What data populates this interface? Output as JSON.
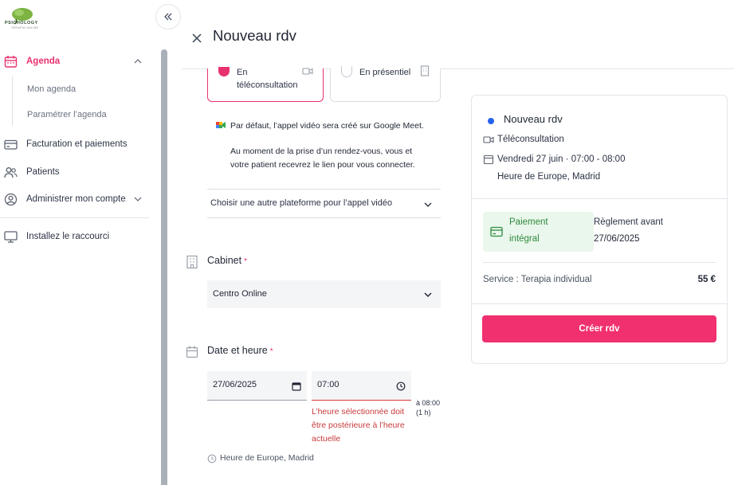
{
  "sidebar": {
    "logo_text": "PSICHOLOGY",
    "logo_sub": "TERAPIA ONLINE",
    "items": [
      {
        "label": "Agenda"
      },
      {
        "label": "Facturation et paiements"
      },
      {
        "label": "Patients"
      },
      {
        "label": "Administrer mon compte"
      },
      {
        "label": "Installez le raccourci"
      }
    ],
    "agenda_sub": [
      {
        "label": "Mon agenda"
      },
      {
        "label": "Paramétrer l’agenda"
      }
    ]
  },
  "header": {
    "title": "Nouveau rdv"
  },
  "modes": {
    "tele_line1": "En",
    "tele_line2": "téléconsultation",
    "presentiel": "En présentiel"
  },
  "video": {
    "info1": "Par défaut, l’appel vidéo sera créé sur Google Meet.",
    "info2": "Au moment de la prise d’un rendez-vous, vous et",
    "info3": "votre patient recevrez le lien pour vous connecter.",
    "platform_select": "Choisir une autre plateforme pour l’appel vidéo"
  },
  "cabinet": {
    "label": "Cabinet",
    "required": "*",
    "value": "Centro Online"
  },
  "datetime": {
    "label": "Date et heure",
    "required": "*",
    "date": "27/06/2025",
    "time": "07:00",
    "end_line1": "à 08:00",
    "end_line2": "(1 h)",
    "error1": "L’heure sélectionnée doit",
    "error2": "être postérieure à l’heure",
    "error3": "actuelle",
    "timezone": "Heure de Europe, Madrid"
  },
  "summary": {
    "title": "Nouveau rdv",
    "mode": "Téléconsultation",
    "datetime": "Vendredi 27 juin · 07:00 - 08:00",
    "timezone": "Heure de Europe, Madrid",
    "payment_line1": "Paiement",
    "payment_line2": "intégral",
    "settle_line1": "Règlement avant",
    "settle_date": "27/06/2025",
    "service": "Service : Terapia individual",
    "price": "55 €",
    "create_label": "Créer rdv"
  },
  "colors": {
    "accent": "#e8316f",
    "button": "#f0306f",
    "success_bg": "#eaf7ec",
    "success_text": "#2f8a3e",
    "error": "#c93b3b",
    "dot": "#2563eb"
  }
}
